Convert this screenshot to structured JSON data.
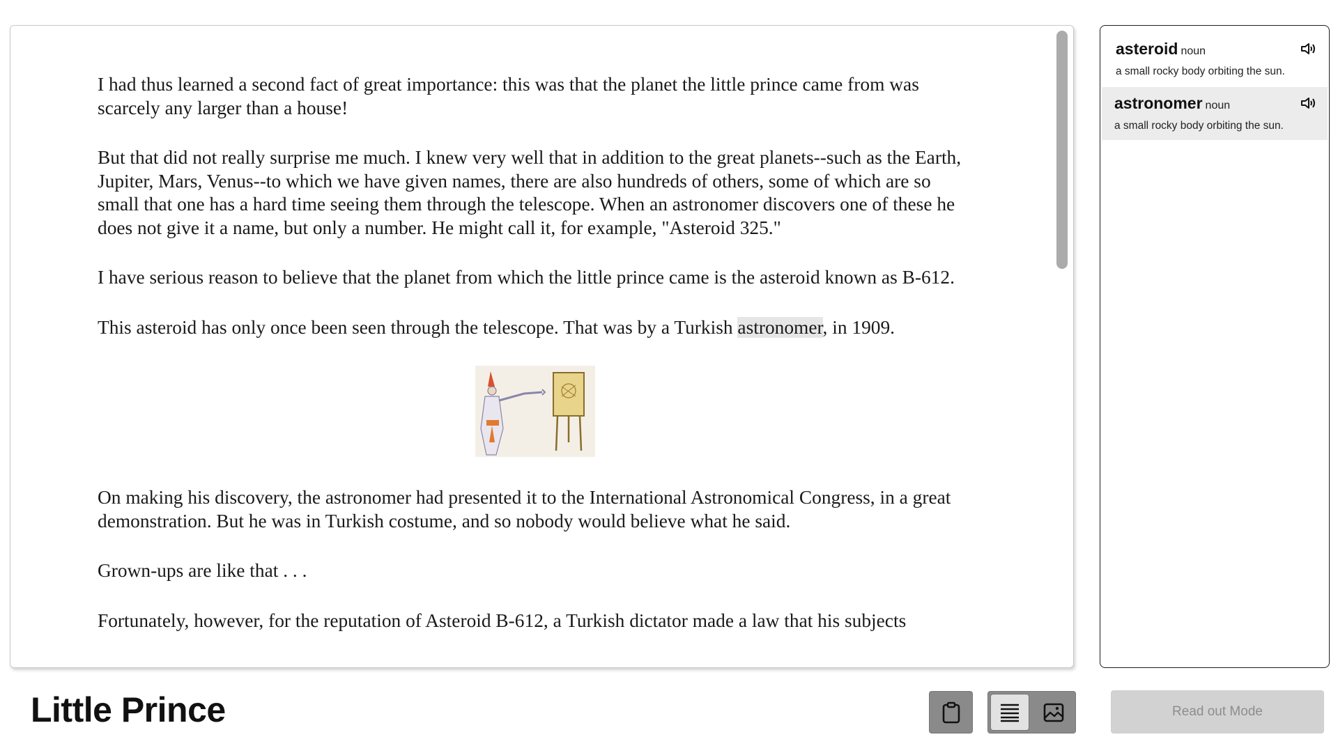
{
  "reader": {
    "paragraphs": [
      "I had thus learned a second fact of great importance: this was that the planet the little prince came from was scarcely any larger than a house!",
      "But that did not really surprise me much. I knew very well that in addition to the great planets--such as the Earth, Jupiter, Mars, Venus--to which we have given names, there are also hundreds of others, some of which are so small that one has a hard time seeing them through the telescope. When an astronomer discovers one of these he does not give it a name, but only a number. He might call it, for example, \"Asteroid 325.\"",
      "I have serious reason to believe that the planet from which the little prince came is the asteroid known as B-612."
    ],
    "p4_before": "This asteroid has only once been seen through the telescope. That was by a Turkish ",
    "p4_highlight": "astronomer",
    "p4_after": ", in 1909.",
    "paragraphs_after_figure": [
      "On making his discovery, the astronomer had presented it to the International Astronomical Congress, in a great demonstration. But he was in Turkish costume, and so nobody would believe what he said.",
      "Grown-ups are like that . . .",
      "Fortunately, however, for the reputation of Asteroid B-612, a Turkish dictator made a law that his subjects"
    ],
    "figure_icon": "turkish-astronomer-illustration"
  },
  "glossary": {
    "items": [
      {
        "word": "asteroid",
        "pos": "noun",
        "definition": "a small rocky body orbiting the sun."
      },
      {
        "word": "astronomer",
        "pos": "noun",
        "definition": "a small rocky body orbiting the sun."
      }
    ]
  },
  "footer": {
    "title": "Little Prince",
    "read_out_label": "Read out Mode"
  },
  "colors": {
    "highlight": "#e6e6e6",
    "toggle_bg": "#8a8a8a",
    "disabled_button": "#d2d2d2"
  }
}
